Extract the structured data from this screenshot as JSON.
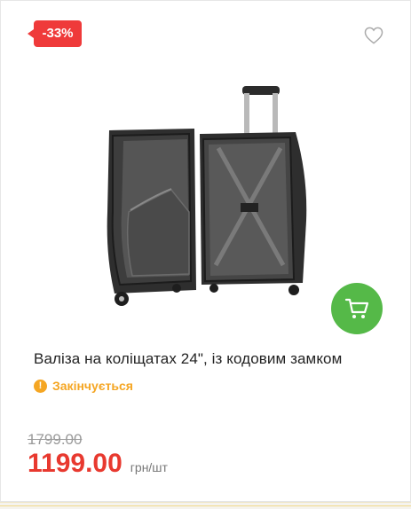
{
  "badge": {
    "discount": "-33%"
  },
  "icons": {
    "wishlist": "heart-outline-icon",
    "cart": "cart-icon",
    "warning": "exclamation-icon"
  },
  "product": {
    "image": "open-black-suitcase",
    "title": "Валіза на коліщатах 24\", із кодовим замком",
    "stock_status": "Закінчується",
    "old_price": "1799.00",
    "price": "1199.00",
    "price_unit": "грн/шт"
  },
  "colors": {
    "badge": "#ef3a3a",
    "cart_button": "#55b948",
    "price": "#e8392f",
    "stock_warning": "#f5a623"
  }
}
